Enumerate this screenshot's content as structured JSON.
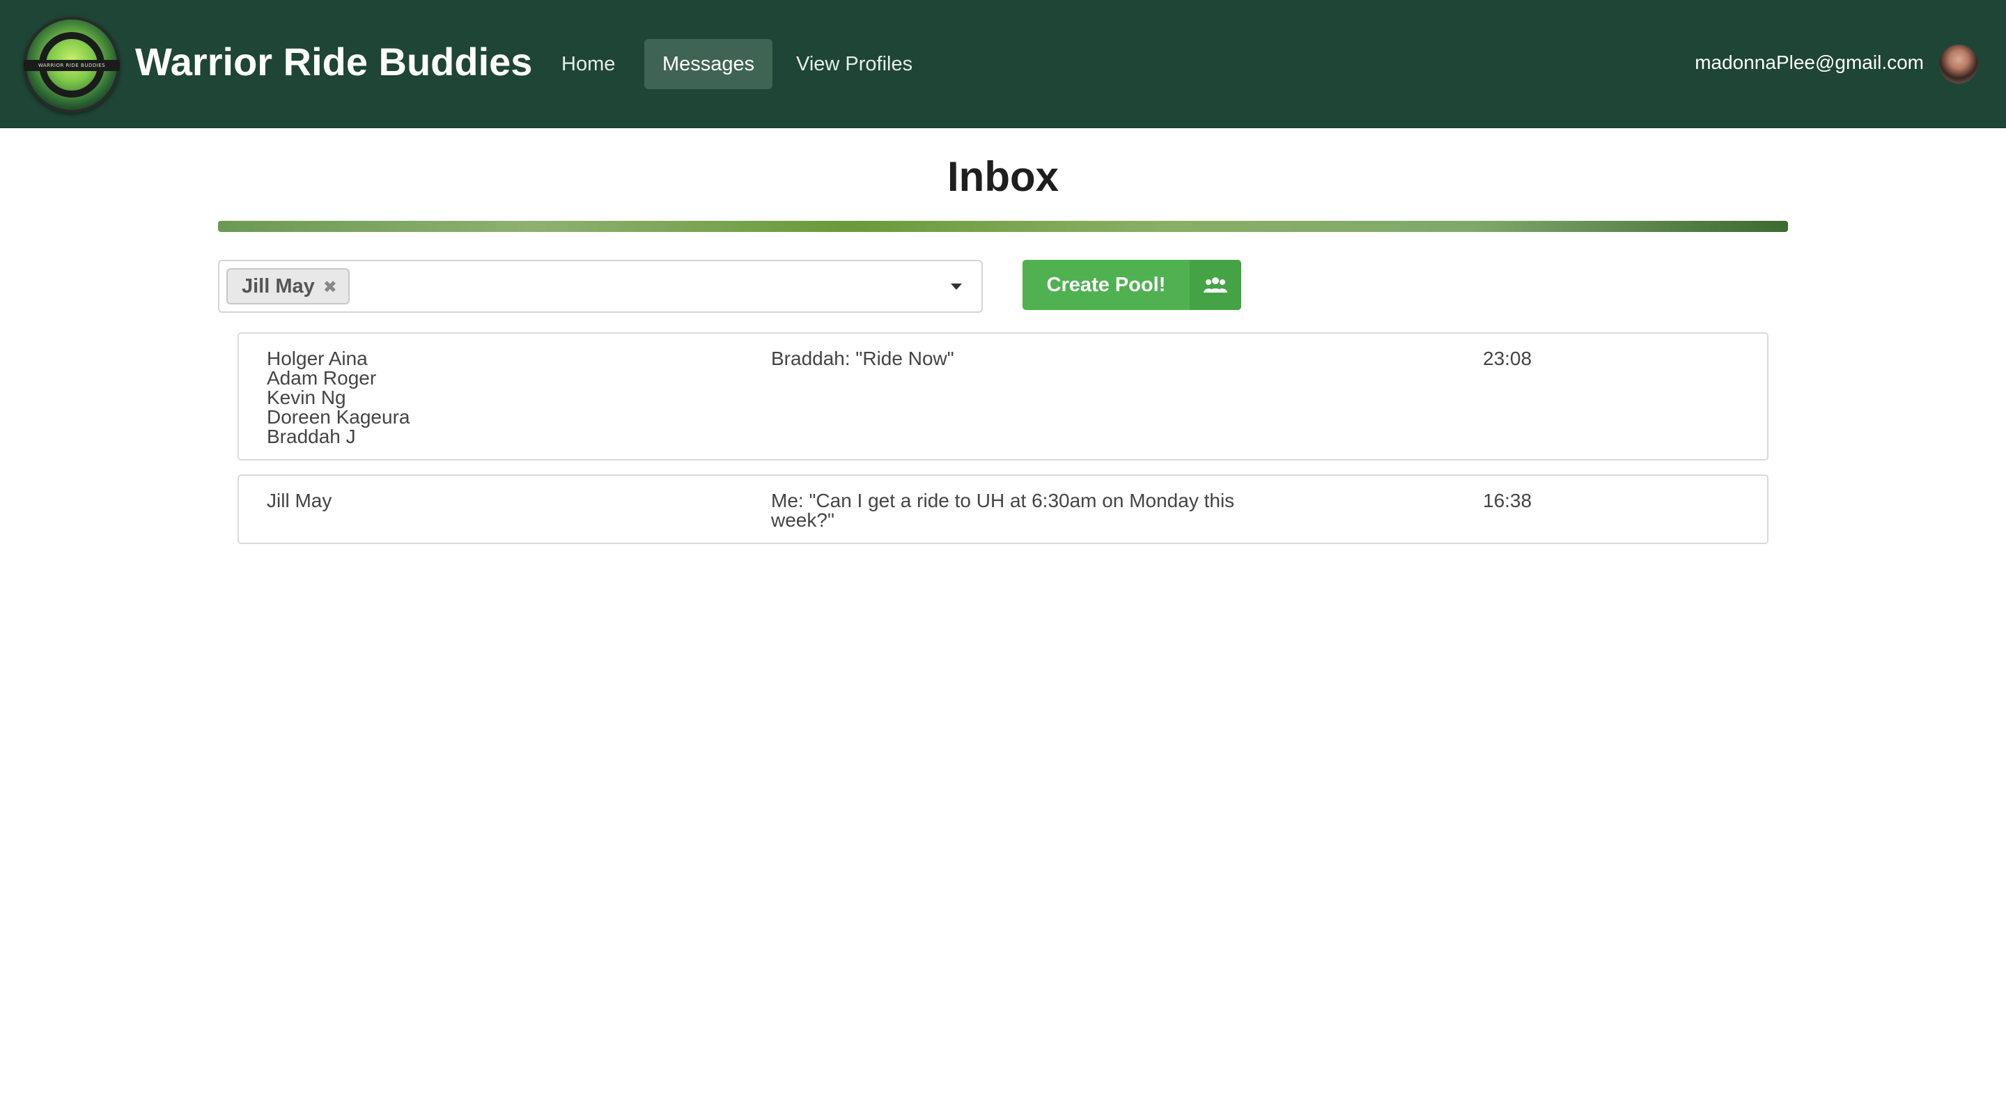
{
  "navbar": {
    "logo_text": "WARRIOR RIDE BUDDIES",
    "brand": "Warrior Ride Buddies",
    "items": [
      {
        "label": "Home",
        "active": false
      },
      {
        "label": "Messages",
        "active": true
      },
      {
        "label": "View Profiles",
        "active": false
      }
    ],
    "user_email": "madonnaPlee@gmail.com"
  },
  "page": {
    "title": "Inbox"
  },
  "filter": {
    "selected_chip": "Jill May"
  },
  "actions": {
    "create_pool_label": "Create Pool!",
    "create_pool_icon": "users-icon"
  },
  "messages": [
    {
      "participants": [
        "Holger Aina",
        "Adam Roger",
        "Kevin Ng",
        "Doreen Kageura",
        "Braddah J"
      ],
      "preview": "Braddah: \"Ride Now\"",
      "time": "23:08"
    },
    {
      "participants": [
        "Jill May"
      ],
      "preview": "Me: \"Can I get a ride to UH at 6:30am on Monday this week?\"",
      "time": "16:38"
    }
  ],
  "colors": {
    "navbar_bg": "#1e4535",
    "nav_active_bg": "#3f6454",
    "button_green": "#4fb150"
  }
}
